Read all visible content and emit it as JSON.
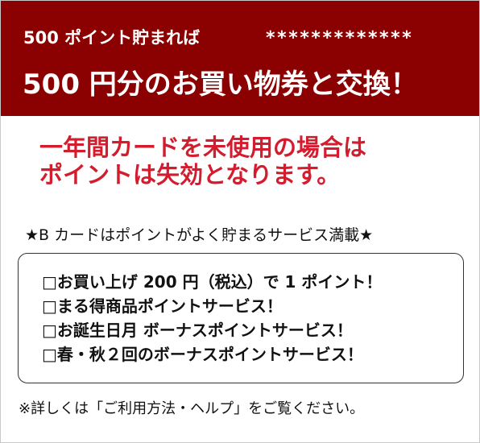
{
  "banner": {
    "line1": "500 ポイント貯まれば",
    "stars": "*************",
    "line2": "500 円分のお買い物券と交換！"
  },
  "warning": {
    "line1": "一年間カードを未使用の場合は",
    "line2": "ポイントは失効となります。"
  },
  "features": {
    "heading": "★B カードはポイントがよく貯まるサービス満載★",
    "items": [
      "□お買い上げ 200 円（税込）で 1 ポイント！",
      "□まる得商品ポイントサービス！",
      "□お誕生日月 ボーナスポイントサービス！",
      "□春・秋２回のボーナスポイントサービス！"
    ]
  },
  "footnote": "※詳しくは「ご利用方法・ヘルプ」をご覧ください。",
  "colors": {
    "banner_background": "#8b0000",
    "warning_text": "#d31d2f"
  }
}
